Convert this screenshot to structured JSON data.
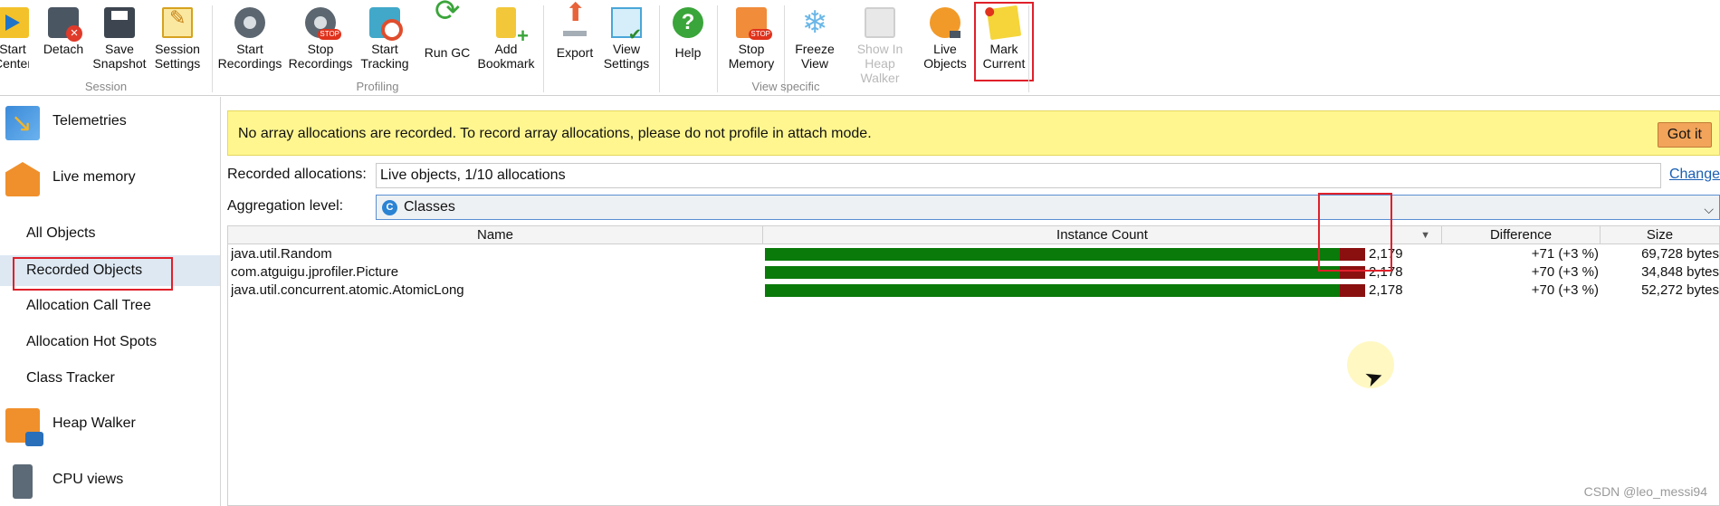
{
  "toolbar": {
    "buttons": [
      {
        "label": "Start\nCenter",
        "icon": "start-center-icon",
        "enabled": true
      },
      {
        "label": "Detach",
        "icon": "detach-icon",
        "enabled": true
      },
      {
        "label": "Save\nSnapshot",
        "icon": "save-snapshot-icon",
        "enabled": true
      },
      {
        "label": "Session\nSettings",
        "icon": "session-settings-icon",
        "enabled": true
      },
      {
        "label": "Start\nRecordings",
        "icon": "start-recordings-icon",
        "enabled": true
      },
      {
        "label": "Stop\nRecordings",
        "icon": "stop-recordings-icon",
        "enabled": true
      },
      {
        "label": "Start\nTracking",
        "icon": "start-tracking-icon",
        "enabled": true
      },
      {
        "label": "Run GC",
        "icon": "run-gc-icon",
        "enabled": true
      },
      {
        "label": "Add\nBookmark",
        "icon": "add-bookmark-icon",
        "enabled": true
      },
      {
        "label": "Export",
        "icon": "export-icon",
        "enabled": true
      },
      {
        "label": "View\nSettings",
        "icon": "view-settings-icon",
        "enabled": true
      },
      {
        "label": "Help",
        "icon": "help-icon",
        "enabled": true
      },
      {
        "label": "Stop\nMemory",
        "icon": "stop-memory-icon",
        "enabled": true
      },
      {
        "label": "Freeze\nView",
        "icon": "freeze-view-icon",
        "enabled": true
      },
      {
        "label": "Show In\nHeap Walker",
        "icon": "show-in-heap-walker-icon",
        "enabled": false
      },
      {
        "label": "Live\nObjects",
        "icon": "live-objects-icon",
        "enabled": true
      },
      {
        "label": "Mark\nCurrent",
        "icon": "mark-current-icon",
        "enabled": true
      }
    ],
    "groups": [
      "Session",
      "Profiling",
      "View specific"
    ],
    "help_glyph": "?",
    "freeze_glyph": "❄"
  },
  "sidebar": {
    "items": [
      {
        "label": "Telemetries",
        "icon": "telemetries-icon",
        "kind": "section"
      },
      {
        "label": "Live memory",
        "icon": "live-memory-icon",
        "kind": "section"
      },
      {
        "label": "All Objects",
        "kind": "view"
      },
      {
        "label": "Recorded Objects",
        "kind": "view",
        "selected": true
      },
      {
        "label": "Allocation Call Tree",
        "kind": "view"
      },
      {
        "label": "Allocation Hot Spots",
        "kind": "view"
      },
      {
        "label": "Class Tracker",
        "kind": "view"
      },
      {
        "label": "Heap Walker",
        "icon": "heap-walker-icon",
        "kind": "section"
      },
      {
        "label": "CPU views",
        "icon": "cpu-views-icon",
        "kind": "section"
      }
    ]
  },
  "main": {
    "banner_text": "No array allocations are recorded. To record array allocations, please do not profile in attach mode.",
    "got_it_label": "Got it",
    "recorded_label": "Recorded allocations:",
    "recorded_value": "Live objects, 1/10 allocations",
    "change_label": "Change",
    "aggregation_label": "Aggregation level:",
    "aggregation_value": "Classes",
    "aggregation_badge": "C",
    "combo_arrow": "⌵"
  },
  "table": {
    "columns": [
      "Name",
      "Instance Count",
      "Difference",
      "Size"
    ],
    "sort_glyph": "▼",
    "rows": [
      {
        "name": "java.util.Random",
        "count": "2,179",
        "count_value": 2179,
        "diff": "+71 (+3 %)",
        "diff_value": 71,
        "size": "69,728 bytes"
      },
      {
        "name": "com.atguigu.jprofiler.Picture",
        "count": "2,178",
        "count_value": 2178,
        "diff": "+70 (+3 %)",
        "diff_value": 70,
        "size": "34,848 bytes"
      },
      {
        "name": "java.util.concurrent.atomic.AtomicLong",
        "count": "2,178",
        "count_value": 2178,
        "diff": "+70 (+3 %)",
        "diff_value": 70,
        "size": "52,272 bytes"
      }
    ],
    "bar_max": 2179
  },
  "watermark": "CSDN @leo_messi94",
  "colors": {
    "bar_green": "#0a7a0a",
    "bar_red": "#8a1010",
    "banner": "#fff68f",
    "highlight": "#e0202a"
  }
}
